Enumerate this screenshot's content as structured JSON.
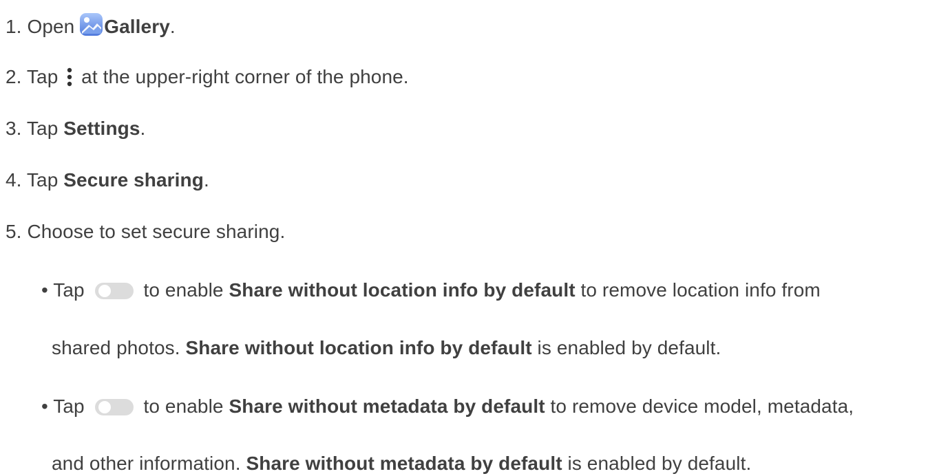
{
  "steps": [
    {
      "num": "1.",
      "pre": " Open ",
      "bold": "Gallery",
      "post": ".",
      "icon": "gallery-icon"
    },
    {
      "num": "2.",
      "pre": " Tap ",
      "post": " at the upper-right corner of the phone.",
      "icon": "more-vertical-icon"
    },
    {
      "num": "3.",
      "pre": " Tap ",
      "bold": "Settings",
      "post": "."
    },
    {
      "num": "4.",
      "pre": " Tap ",
      "bold": "Secure sharing",
      "post": "."
    },
    {
      "num": "5.",
      "text": " Choose to set secure sharing."
    }
  ],
  "bullets": [
    {
      "marker": "• ",
      "pre": "Tap ",
      "icon": "toggle-switch-icon",
      "mid": " to enable ",
      "bold": "Share without location info by default",
      "post": " to remove location info from",
      "cont_pre": "shared photos. ",
      "cont_bold": "Share without location info by default",
      "cont_post": " is enabled by default."
    },
    {
      "marker": "• ",
      "pre": "Tap ",
      "icon": "toggle-switch-icon",
      "mid": " to enable ",
      "bold": "Share without metadata by default",
      "post": " to remove device model, metadata,",
      "cont_pre": "and other information. ",
      "cont_bold": "Share without metadata by default",
      "cont_post": " is enabled by default."
    }
  ],
  "colors": {
    "text": "#404040",
    "gallery_icon_top": "#8fb4f5",
    "gallery_icon_bottom": "#4b73d8",
    "toggle_track": "#dcdcdc",
    "toggle_knob": "#ffffff"
  }
}
